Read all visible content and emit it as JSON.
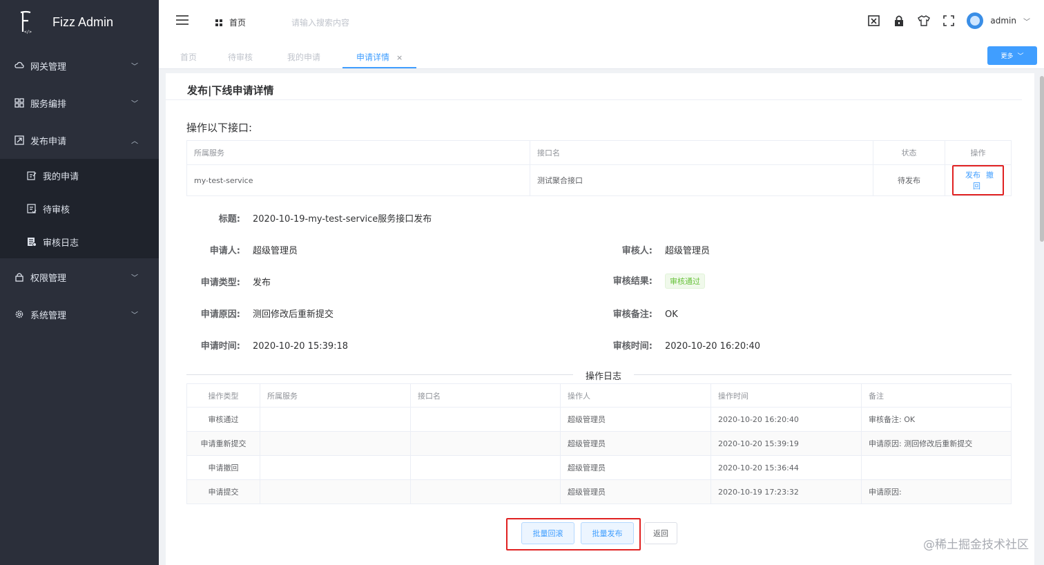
{
  "app": {
    "name": "Fizz Admin"
  },
  "sidebar": {
    "items": [
      {
        "label": "网关管理",
        "icon": "cloud-icon",
        "arrow": "﹀"
      },
      {
        "label": "服务编排",
        "icon": "grid-icon",
        "arrow": "﹀"
      },
      {
        "label": "发布申请",
        "icon": "publish-icon",
        "arrow": "︿"
      }
    ],
    "submenu": [
      {
        "label": "我的申请",
        "icon": "edit-doc-icon"
      },
      {
        "label": "待审核",
        "icon": "review-icon"
      },
      {
        "label": "审核日志",
        "icon": "log-icon"
      }
    ],
    "items2": [
      {
        "label": "权限管理",
        "icon": "lock-icon",
        "arrow": "﹀"
      },
      {
        "label": "系统管理",
        "icon": "gear-icon",
        "arrow": "﹀"
      }
    ]
  },
  "header": {
    "home": "首页",
    "search_placeholder": "请输入搜索内容",
    "user": "admin",
    "caret": "﹀"
  },
  "tabs": {
    "items": [
      "首页",
      "待审核",
      "我的申请",
      "申请详情"
    ],
    "close": "×",
    "more": "更多",
    "more_caret": "﹀"
  },
  "page": {
    "title": "发布|下线申请详情",
    "section": "操作以下接口:",
    "api_table": {
      "headers": [
        "所属服务",
        "接口名",
        "状态",
        "操作"
      ],
      "row": {
        "service": "my-test-service",
        "api": "测试聚合接口",
        "status": "待发布",
        "op_publish": "发布",
        "op_revoke": "撤回"
      }
    },
    "details": {
      "title_label": "标题:",
      "title_value": "2020-10-19-my-test-service服务接口发布",
      "applicant_label": "申请人:",
      "applicant_value": "超级管理员",
      "reviewer_label": "审核人:",
      "reviewer_value": "超级管理员",
      "type_label": "申请类型:",
      "type_value": "发布",
      "result_label": "审核结果:",
      "result_value": "审核通过",
      "reason_label": "申请原因:",
      "reason_value": "测回修改后重新提交",
      "remark_label": "审核备注:",
      "remark_value": "OK",
      "apply_time_label": "申请时间:",
      "apply_time_value": "2020-10-20 15:39:18",
      "review_time_label": "审核时间:",
      "review_time_value": "2020-10-20 16:20:40"
    },
    "log_title": "操作日志",
    "log_table": {
      "headers": [
        "操作类型",
        "所属服务",
        "接口名",
        "操作人",
        "操作时间",
        "备注"
      ],
      "rows": [
        [
          "审核通过",
          "",
          "",
          "超级管理员",
          "2020-10-20 16:20:40",
          "审核备注: OK"
        ],
        [
          "申请重新提交",
          "",
          "",
          "超级管理员",
          "2020-10-20 15:39:19",
          "申请原因: 测回修改后重新提交"
        ],
        [
          "申请撤回",
          "",
          "",
          "超级管理员",
          "2020-10-20 15:36:44",
          ""
        ],
        [
          "申请提交",
          "",
          "",
          "超级管理员",
          "2020-10-19 17:23:32",
          "申请原因:"
        ]
      ]
    },
    "buttons": {
      "rollback": "批量回滚",
      "publish": "批量发布",
      "back": "返回"
    }
  },
  "watermark": "@稀土掘金技术社区"
}
